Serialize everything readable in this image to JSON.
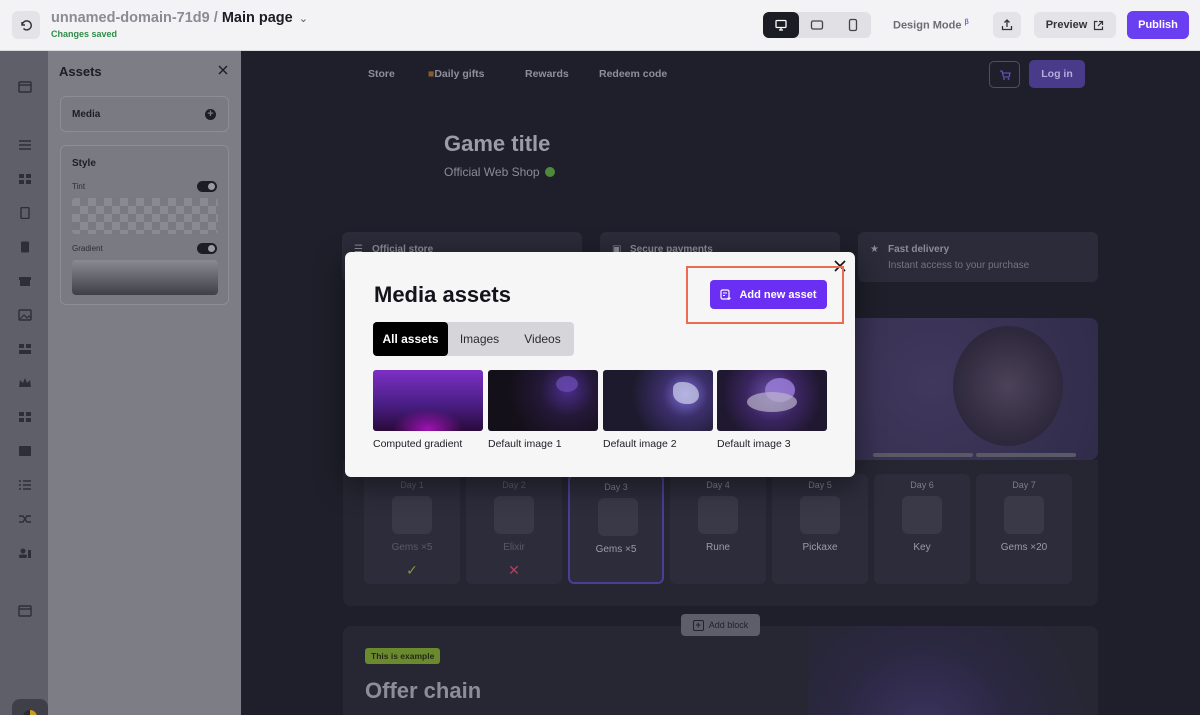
{
  "topbar": {
    "project_name": "unnamed-domain-71d9",
    "separator": " / ",
    "page_name": "Main page",
    "status": "Changes saved",
    "design_mode": "Design Mode",
    "design_mode_badge": "β",
    "preview_label": "Preview",
    "publish_label": "Publish"
  },
  "assets_panel": {
    "title": "Assets",
    "media_label": "Media",
    "style_label": "Style",
    "tint_label": "Tint",
    "gradient_label": "Gradient"
  },
  "store": {
    "nav": [
      "Store",
      "Daily gifts",
      "Rewards",
      "Redeem code"
    ],
    "login_label": "Log in",
    "game_title": "Game title",
    "game_subtitle": "Official Web Shop",
    "features": [
      {
        "title": "Official store",
        "subtitle": ""
      },
      {
        "title": "Secure payments",
        "subtitle": ""
      },
      {
        "title": "Fast delivery",
        "subtitle": "Instant access to your purchase"
      }
    ],
    "days": [
      {
        "day": "Day 1",
        "name": "Gems ×5",
        "state": "claimed"
      },
      {
        "day": "Day 2",
        "name": "Elixir",
        "state": "missed"
      },
      {
        "day": "Day 3",
        "name": "Gems ×5",
        "state": "current"
      },
      {
        "day": "Day 4",
        "name": "Rune",
        "state": "upcoming"
      },
      {
        "day": "Day 5",
        "name": "Pickaxe",
        "state": "upcoming"
      },
      {
        "day": "Day 6",
        "name": "Key",
        "state": "upcoming"
      },
      {
        "day": "Day 7",
        "name": "Gems ×20",
        "state": "upcoming"
      }
    ],
    "add_block_label": "Add block",
    "example_badge": "This is example",
    "offer_title": "Offer chain"
  },
  "modal": {
    "title": "Media assets",
    "add_button_label": "Add new asset",
    "tabs": [
      "All assets",
      "Images",
      "Videos"
    ],
    "active_tab": "All assets",
    "assets": [
      {
        "label": "Computed gradient",
        "thumb": "gradient"
      },
      {
        "label": "Default image 1",
        "thumb": "image"
      },
      {
        "label": "Default image 2",
        "thumb": "image"
      },
      {
        "label": "Default image 3",
        "thumb": "image"
      }
    ]
  },
  "colors": {
    "accent": "#6a2ff2",
    "highlight_border": "#ec6b52",
    "status_green": "#2f8d49"
  }
}
